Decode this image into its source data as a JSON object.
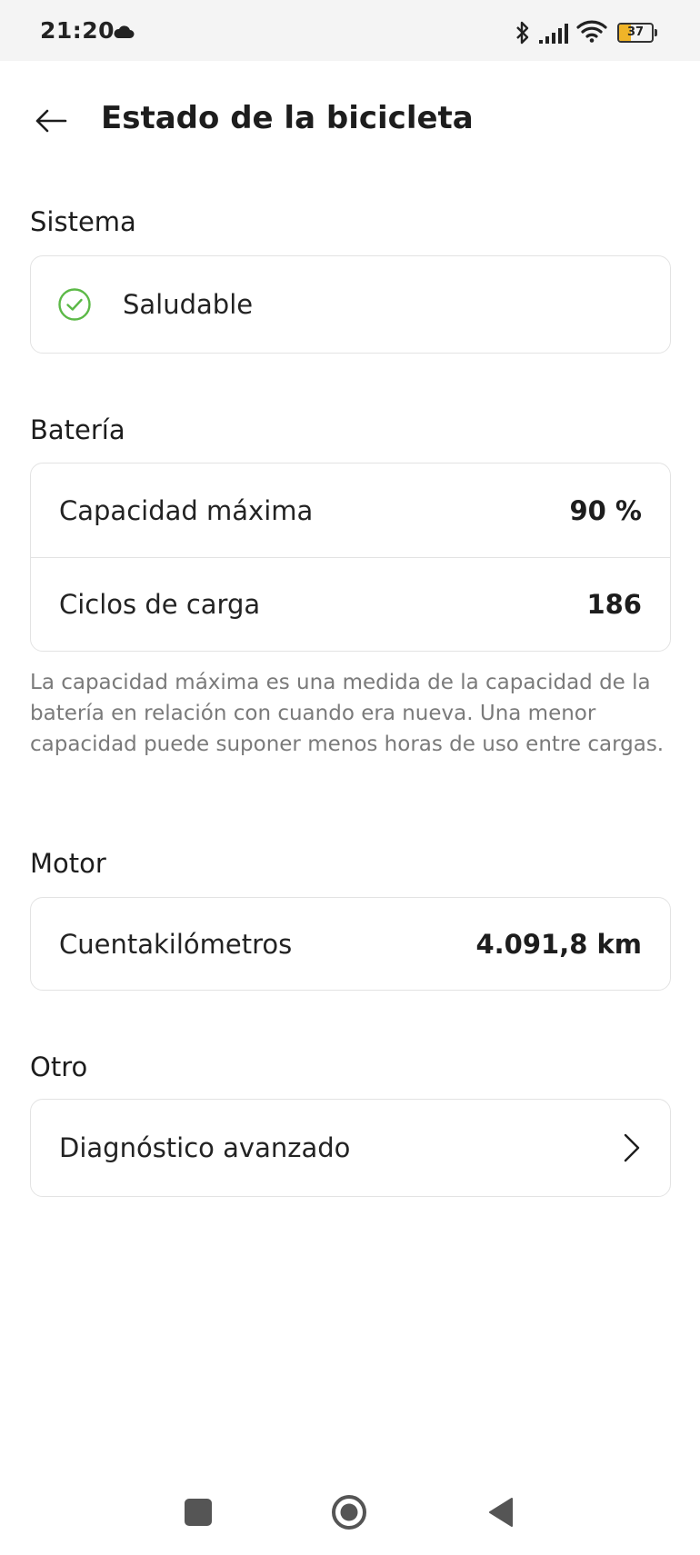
{
  "status_bar": {
    "time": "21:20",
    "battery_level": "37",
    "battery_fraction": 0.37,
    "icons": [
      "cloud-icon",
      "bluetooth-icon",
      "signal-icon",
      "wifi-icon",
      "battery-icon"
    ]
  },
  "header": {
    "title": "Estado de la bicicleta",
    "back_icon": "arrow-left-icon"
  },
  "system": {
    "title": "Sistema",
    "status": "Saludable",
    "status_icon": "check-circle-icon",
    "status_color": "#5cb947"
  },
  "battery": {
    "title": "Batería",
    "rows": [
      {
        "label": "Capacidad máxima",
        "value": "90 %"
      },
      {
        "label": "Ciclos de carga",
        "value": "186"
      }
    ],
    "footnote": "La capacidad máxima es una medida de la capacidad de la batería en relación con cuando era nueva. Una menor capacidad puede suponer menos horas de uso entre cargas."
  },
  "motor": {
    "title": "Motor",
    "rows": [
      {
        "label": "Cuentakilómetros",
        "value": "4.091,8 km"
      }
    ]
  },
  "other": {
    "title": "Otro",
    "rows": [
      {
        "label": "Diagnóstico avanzado",
        "icon": "chevron-right-icon"
      }
    ]
  },
  "nav_bar": {
    "icons": [
      "recents-square-icon",
      "home-circle-icon",
      "back-triangle-icon"
    ]
  }
}
